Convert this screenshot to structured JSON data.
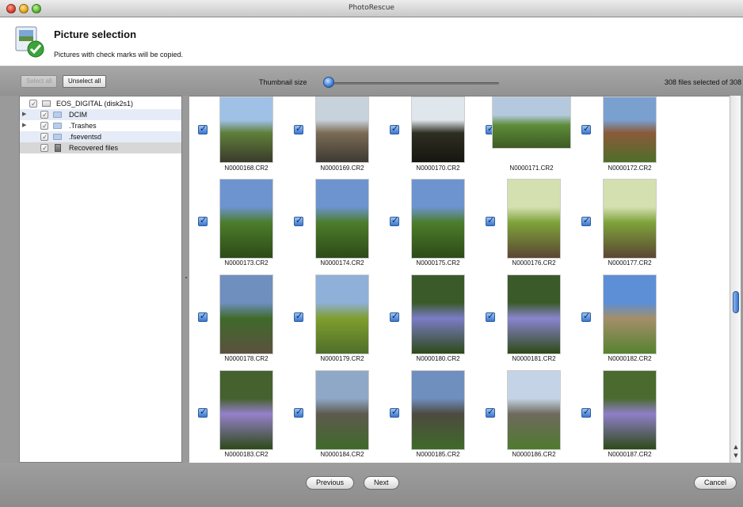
{
  "window": {
    "title": "PhotoRescue"
  },
  "header": {
    "title": "Picture selection",
    "subtitle": "Pictures with check marks will be copied."
  },
  "toolbar": {
    "select_all": "Select all",
    "unselect_all": "Unselect all",
    "thumbnail_size_label": "Thumbnail size",
    "thumbnail_size_level": 0.0,
    "files_selected": "308 files selected of 308"
  },
  "tree": {
    "items": [
      {
        "label": "EOS_DIGITAL (disk2s1)",
        "icon": "disk-icon",
        "checked": true,
        "expandable": false
      },
      {
        "label": "DCIM",
        "icon": "folder-icon",
        "checked": true,
        "expandable": true
      },
      {
        "label": ".Trashes",
        "icon": "folder-icon",
        "checked": true,
        "expandable": true
      },
      {
        "label": ".fseventsd",
        "icon": "folder-icon",
        "checked": true,
        "expandable": false
      },
      {
        "label": "Recovered files",
        "icon": "trash-icon",
        "checked": true,
        "expandable": false
      }
    ]
  },
  "grid": {
    "files": [
      {
        "name": "N0000168.CR2",
        "checked": true
      },
      {
        "name": "N0000169.CR2",
        "checked": true
      },
      {
        "name": "N0000170.CR2",
        "checked": true
      },
      {
        "name": "N0000171.CR2",
        "checked": true
      },
      {
        "name": "N0000172.CR2",
        "checked": true
      },
      {
        "name": "N0000173.CR2",
        "checked": true
      },
      {
        "name": "N0000174.CR2",
        "checked": true
      },
      {
        "name": "N0000175.CR2",
        "checked": true
      },
      {
        "name": "N0000176.CR2",
        "checked": true
      },
      {
        "name": "N0000177.CR2",
        "checked": true
      },
      {
        "name": "N0000178.CR2",
        "checked": true
      },
      {
        "name": "N0000179.CR2",
        "checked": true
      },
      {
        "name": "N0000180.CR2",
        "checked": true
      },
      {
        "name": "N0000181.CR2",
        "checked": true
      },
      {
        "name": "N0000182.CR2",
        "checked": true
      },
      {
        "name": "N0000183.CR2",
        "checked": true
      },
      {
        "name": "N0000184.CR2",
        "checked": true
      },
      {
        "name": "N0000185.CR2",
        "checked": true
      },
      {
        "name": "N0000186.CR2",
        "checked": true
      },
      {
        "name": "N0000187.CR2",
        "checked": true
      }
    ]
  },
  "footer": {
    "previous": "Previous",
    "next": "Next",
    "cancel": "Cancel"
  }
}
